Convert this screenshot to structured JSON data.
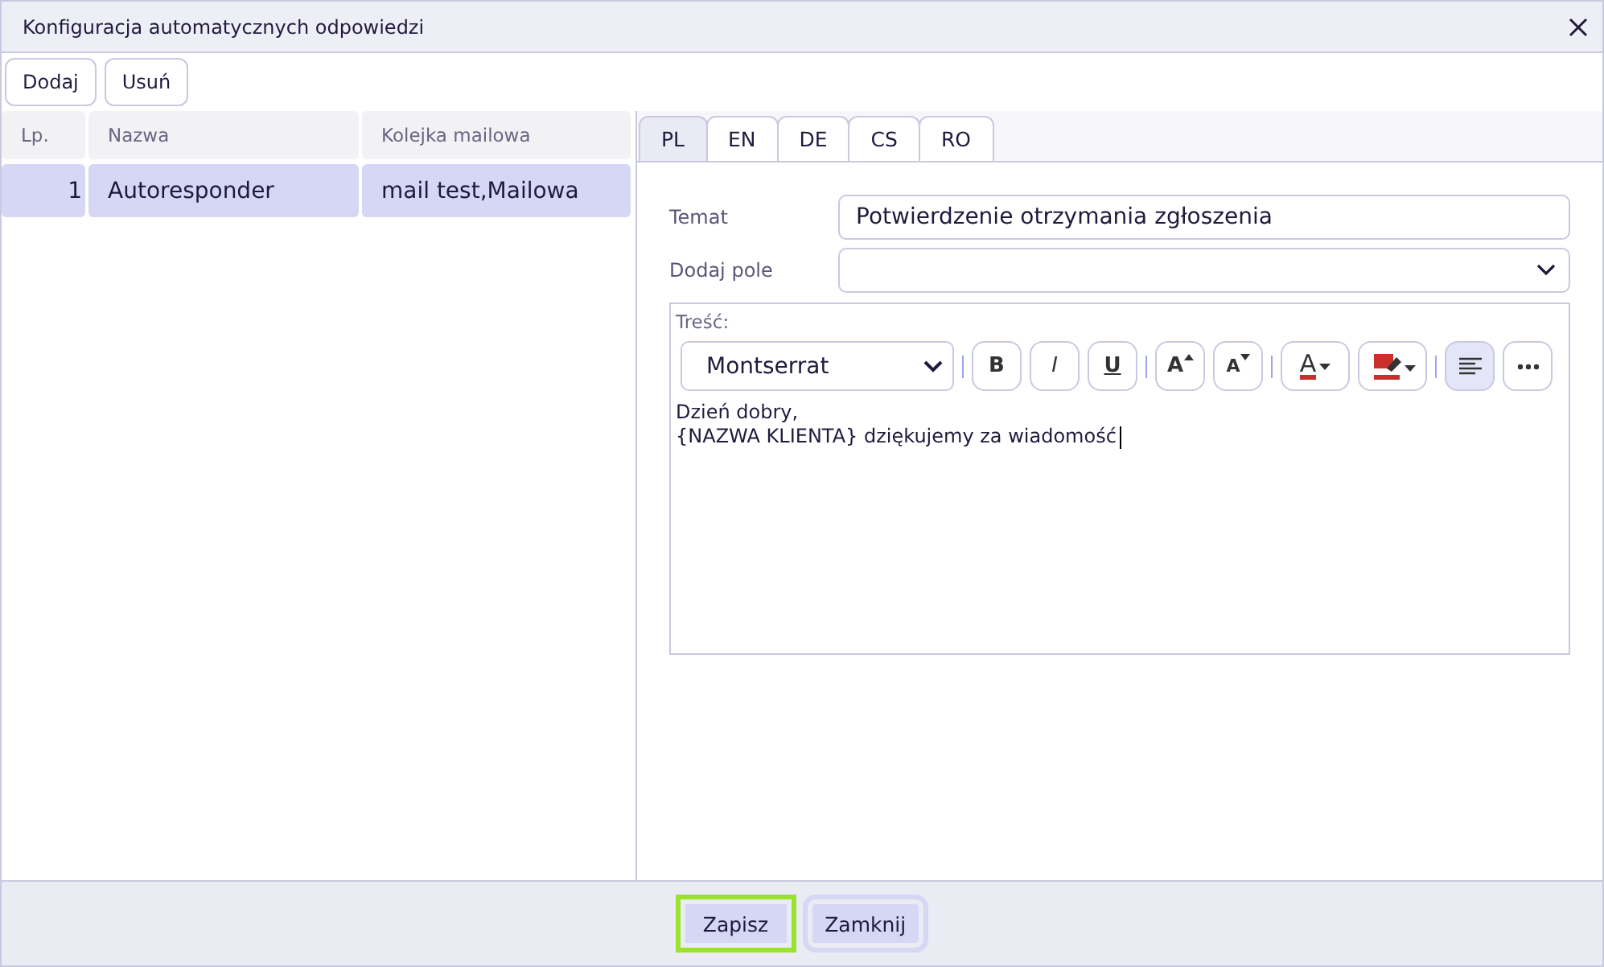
{
  "window": {
    "title": "Konfiguracja automatycznych odpowiedzi"
  },
  "toolbar": [
    "Dodaj",
    "Usuń"
  ],
  "table": {
    "columns": [
      "Lp.",
      "Nazwa",
      "Kolejka mailowa"
    ],
    "rows": [
      {
        "cells": [
          "1",
          "Autoresponder",
          "mail test,Mailowa"
        ],
        "selected": true
      }
    ]
  },
  "tabs": [
    {
      "label": "PL",
      "selected": true
    },
    {
      "label": "EN",
      "selected": false
    },
    {
      "label": "DE",
      "selected": false
    },
    {
      "label": "CS",
      "selected": false
    },
    {
      "label": "RO",
      "selected": false
    }
  ],
  "form": {
    "subject_label": "Temat",
    "subject_value": "Potwierdzenie otrzymania zgłoszenia",
    "add_field_label": "Dodaj pole",
    "body_label": "Treść:"
  },
  "editor": {
    "font": "Montserrat",
    "tools": [
      {
        "kind": "bold",
        "label": "B",
        "selected": false
      },
      {
        "kind": "italic",
        "label": "I",
        "selected": false
      },
      {
        "kind": "underline",
        "label": "U",
        "selected": false
      },
      {
        "kind": "grow",
        "label": "A",
        "selected": false
      },
      {
        "kind": "shrink",
        "label": "A",
        "selected": false
      },
      {
        "kind": "color",
        "label": "A",
        "selected": false
      },
      {
        "kind": "highlight",
        "selected": false
      },
      {
        "kind": "align",
        "selected": true
      },
      {
        "kind": "more",
        "selected": false
      }
    ],
    "lines": [
      "Dzień dobry,",
      "{NAZWA KLIENTA} dziękujemy za wiadomość"
    ]
  },
  "footer": [
    {
      "label": "Zapisz",
      "focused": true
    },
    {
      "label": "Zamknij",
      "focused": false
    }
  ]
}
